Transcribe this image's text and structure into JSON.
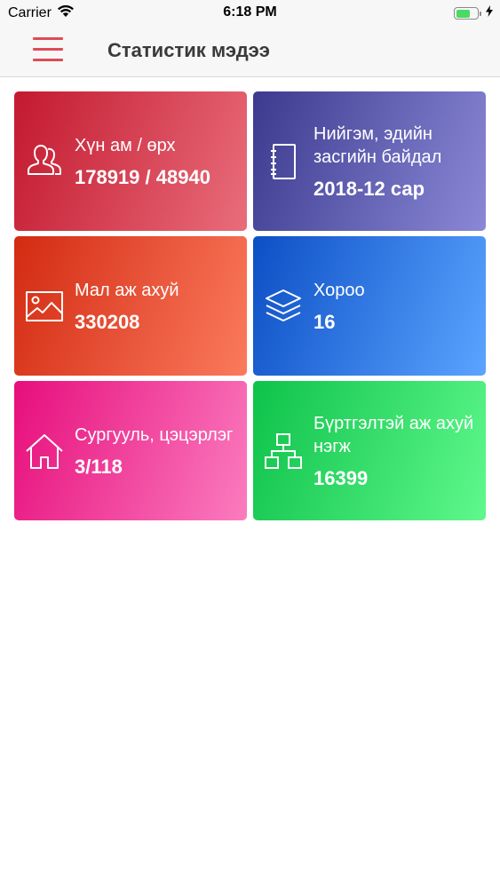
{
  "status_bar": {
    "carrier": "Carrier",
    "time": "6:18 PM",
    "battery_level": 0.7
  },
  "nav": {
    "title": "Статистик мэдээ"
  },
  "cards": [
    {
      "label": "Хүн ам / өрх",
      "value": "178919 / 48940",
      "icon": "users-icon",
      "color_from": "#c3192f",
      "color_to": "#e96d7b"
    },
    {
      "label": "Нийгэм, эдийн засгийн байдал",
      "value": "2018-12 сар",
      "icon": "notebook-icon",
      "color_from": "#3c3a8e",
      "color_to": "#8a88d6"
    },
    {
      "label": "Мал аж ахуй",
      "value": "330208",
      "icon": "image-icon",
      "color_from": "#d32b12",
      "color_to": "#fb7a5d"
    },
    {
      "label": "Хороо",
      "value": "16",
      "icon": "layers-icon",
      "color_from": "#0c4fc6",
      "color_to": "#5ba4ff"
    },
    {
      "label": "Сургууль, цэцэрлэг",
      "value": "3/118",
      "icon": "home-icon",
      "color_from": "#e70e7c",
      "color_to": "#fb7cbf"
    },
    {
      "label": "Бүртгэлтэй аж ахуй нэгж",
      "value": "16399",
      "icon": "sitemap-icon",
      "color_from": "#0ec24a",
      "color_to": "#5ff88c"
    }
  ]
}
